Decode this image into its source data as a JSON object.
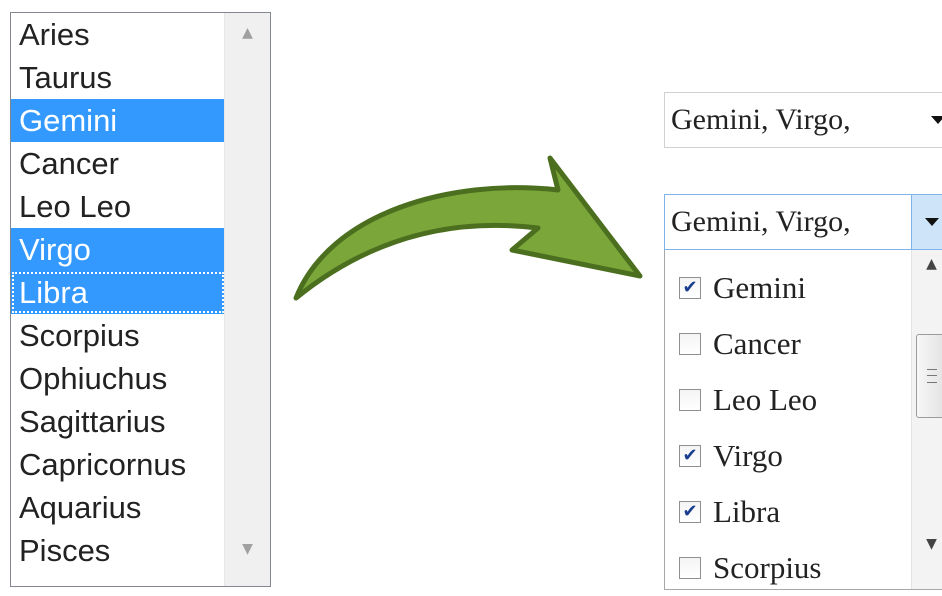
{
  "listbox": {
    "items": [
      {
        "label": "Aries",
        "selected": false
      },
      {
        "label": "Taurus",
        "selected": false
      },
      {
        "label": "Gemini",
        "selected": true
      },
      {
        "label": "Cancer",
        "selected": false
      },
      {
        "label": "Leo Leo",
        "selected": false
      },
      {
        "label": "Virgo",
        "selected": true
      },
      {
        "label": "Libra",
        "selected": true
      },
      {
        "label": "Scorpius",
        "selected": false
      },
      {
        "label": "Ophiuchus",
        "selected": false
      },
      {
        "label": "Sagittarius",
        "selected": false
      },
      {
        "label": "Capricornus",
        "selected": false
      },
      {
        "label": "Aquarius",
        "selected": false
      },
      {
        "label": "Pisces",
        "selected": false
      }
    ],
    "selection_color": "#3399ff"
  },
  "arrow": {
    "color": "#7aa63a",
    "outline_color": "#4b6f1f"
  },
  "dropdown_closed": {
    "value": "Gemini, Virgo,"
  },
  "dropdown_open": {
    "value": "Gemini, Virgo,",
    "options": [
      {
        "label": "Gemini",
        "checked": true
      },
      {
        "label": "Cancer",
        "checked": false
      },
      {
        "label": "Leo Leo",
        "checked": false
      },
      {
        "label": "Virgo",
        "checked": true
      },
      {
        "label": "Libra",
        "checked": true
      },
      {
        "label": "Scorpius",
        "checked": false
      }
    ]
  }
}
